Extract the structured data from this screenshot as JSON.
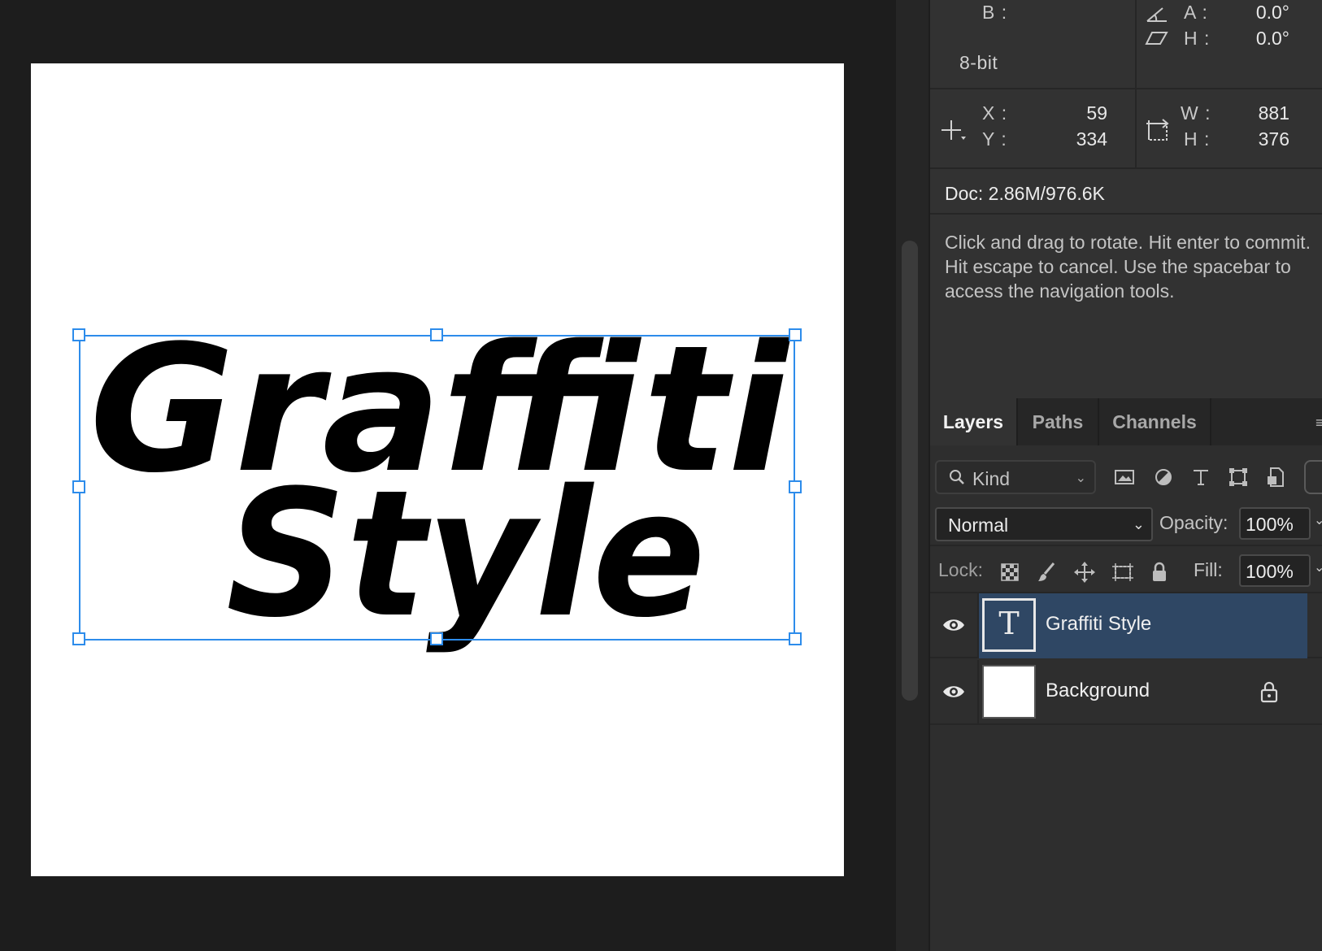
{
  "canvas": {
    "text_layer_line1": "Graffiti",
    "text_layer_line2": "Style",
    "background_color": "#ffffff",
    "selection_color": "#2d8ceb"
  },
  "info_panel": {
    "b_label": "B :",
    "bit_depth": "8-bit",
    "angle_label": "A :",
    "angle_value": "0.0°",
    "skew_label": "H :",
    "skew_value": "0.0°",
    "x_label": "X :",
    "x_value": "59",
    "y_label": "Y :",
    "y_value": "334",
    "w_label": "W :",
    "w_value": "881",
    "h_label": "H :",
    "h_value": "376",
    "doc_size": "Doc: 2.86M/976.6K",
    "hint": "Click and drag to rotate. Hit enter to commit. Hit escape to cancel. Use the spacebar to access the navigation tools."
  },
  "layers_panel": {
    "tabs": [
      "Layers",
      "Paths",
      "Channels"
    ],
    "active_tab": "Layers",
    "kind_label": "Kind",
    "filter_icons": [
      "image-filter-icon",
      "adjustment-filter-icon",
      "type-filter-icon",
      "shape-filter-icon",
      "smart-object-filter-icon"
    ],
    "blend_mode": "Normal",
    "opacity_label": "Opacity:",
    "opacity_value": "100%",
    "lock_label": "Lock:",
    "fill_label": "Fill:",
    "fill_value": "100%",
    "layers": [
      {
        "name": "Graffiti Style",
        "type": "text",
        "thumb_glyph": "T",
        "selected": true,
        "visible": true,
        "locked": false
      },
      {
        "name": "Background",
        "type": "raster",
        "selected": false,
        "visible": true,
        "locked": true
      }
    ],
    "selected_color": "#2f4764"
  }
}
